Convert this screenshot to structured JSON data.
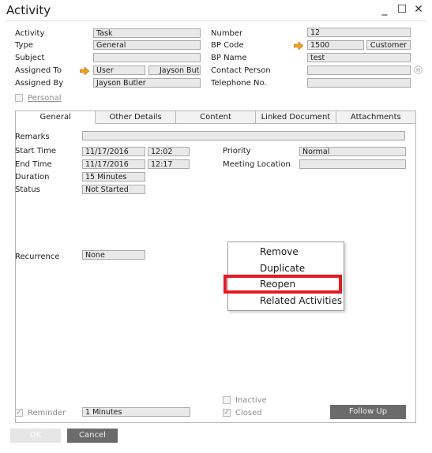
{
  "window": {
    "title": "Activity",
    "minimize": "_",
    "maximize": "☐",
    "close": "✕"
  },
  "header": {
    "activity_label": "Activity",
    "activity_value": "Task",
    "type_label": "Type",
    "type_value": "General",
    "subject_label": "Subject",
    "subject_value": "",
    "assigned_to_label": "Assigned To",
    "assigned_to_kind": "User",
    "assigned_to_name": "Jayson Butler",
    "assigned_by_label": "Assigned By",
    "assigned_by_value": "Jayson Butler",
    "personal_label": "Personal",
    "number_label": "Number",
    "number_value": "12",
    "bp_code_label": "BP Code",
    "bp_code_value": "1500",
    "bp_code_type": "Customer",
    "bp_name_label": "BP Name",
    "bp_name_value": "test",
    "contact_person_label": "Contact Person",
    "contact_person_value": "",
    "telephone_label": "Telephone No.",
    "telephone_value": ""
  },
  "tabs": [
    {
      "label": "General",
      "underline": "l",
      "active": true
    },
    {
      "label": "Other Details",
      "underline": "O"
    },
    {
      "label": "Content",
      "underline": "C"
    },
    {
      "label": "Linked Document",
      "underline": "n"
    },
    {
      "label": "Attachments",
      "underline": "A"
    }
  ],
  "general": {
    "remarks_label": "Remarks",
    "remarks_value": "",
    "start_time_label": "Start Time",
    "start_date": "11/17/2016",
    "start_time": "12:02",
    "end_time_label": "End Time",
    "end_date": "11/17/2016",
    "end_time": "12:17",
    "duration_label": "Duration",
    "duration_value": "15 Minutes",
    "status_label": "Status",
    "status_value": "Not Started",
    "priority_label": "Priority",
    "priority_value": "Normal",
    "meeting_location_label": "Meeting Location",
    "meeting_location_value": "",
    "recurrence_label": "Recurrence",
    "recurrence_value": "None",
    "reminder_label": "Reminder",
    "reminder_value": "1 Minutes",
    "inactive_label": "Inactive",
    "closed_label": "Closed",
    "follow_up_label": "Follow Up"
  },
  "context_menu": {
    "items": [
      "Remove",
      "Duplicate",
      "Reopen",
      "Related Activities"
    ],
    "highlighted": "Reopen"
  },
  "footer": {
    "ok_label": "OK",
    "cancel_label": "Cancel"
  },
  "colors": {
    "highlight": "#e41a24",
    "arrow": "#f0a020",
    "button_dark": "#6b6b6b"
  }
}
